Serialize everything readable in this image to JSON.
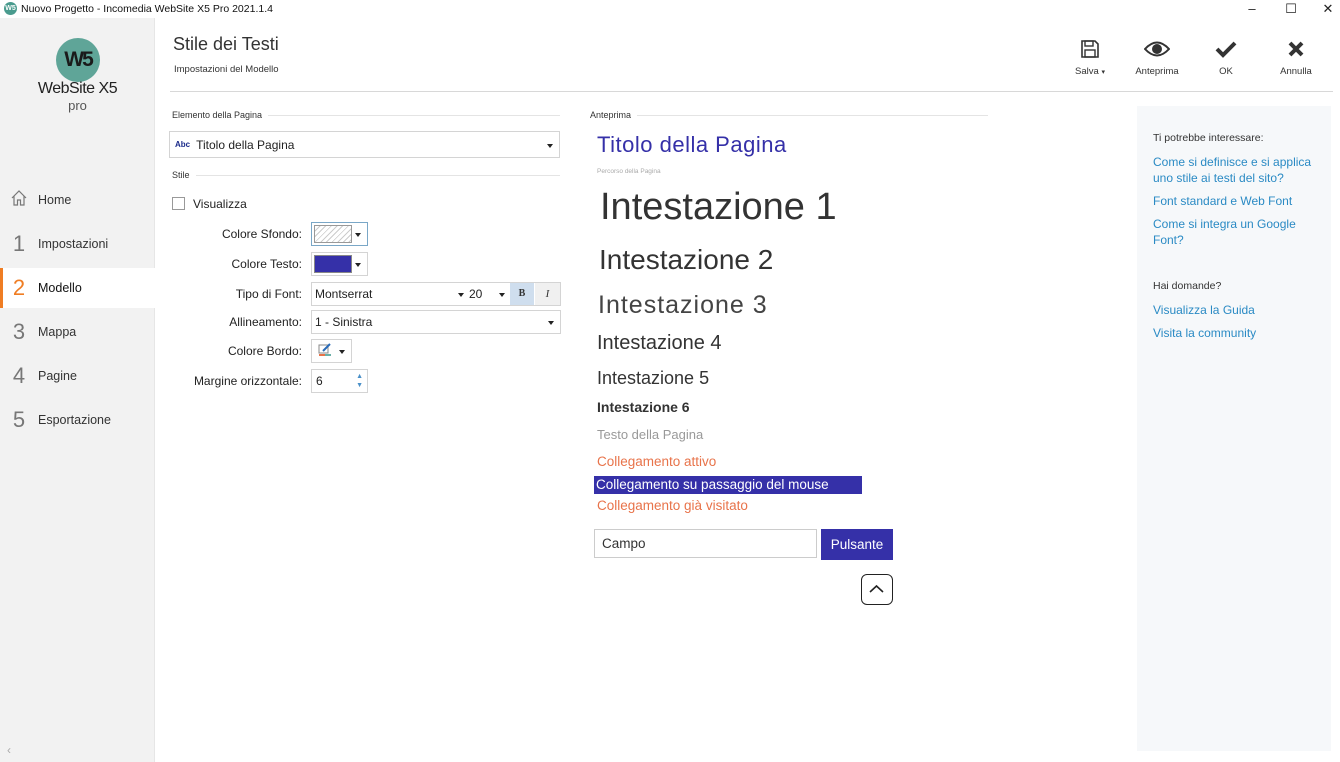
{
  "window": {
    "title": "Nuovo Progetto - Incomedia WebSite X5 Pro 2021.1.4",
    "app_icon": "W5",
    "controls": {
      "minimize": "–",
      "maximize": "☐",
      "close": "✕"
    }
  },
  "logo": {
    "mark": "W5",
    "name": "WebSite X5",
    "edition": "pro"
  },
  "sidebar": {
    "items": [
      {
        "num": "",
        "label": "Home",
        "icon": "home-icon"
      },
      {
        "num": "1",
        "label": "Impostazioni"
      },
      {
        "num": "2",
        "label": "Modello",
        "active": true
      },
      {
        "num": "3",
        "label": "Mappa"
      },
      {
        "num": "4",
        "label": "Pagine"
      },
      {
        "num": "5",
        "label": "Esportazione"
      }
    ],
    "collapse": "‹"
  },
  "header": {
    "title": "Stile dei Testi",
    "subtitle": "Impostazioni del Modello"
  },
  "toolbar": {
    "save": "Salva",
    "preview": "Anteprima",
    "ok": "OK",
    "cancel": "Annulla"
  },
  "form": {
    "element_section": "Elemento della Pagina",
    "element_icon": "Abc",
    "element_value": "Titolo della Pagina",
    "style_section": "Stile",
    "show_label": "Visualizza",
    "show_checked": false,
    "bg_color_label": "Colore Sfondo:",
    "text_color_label": "Colore Testo:",
    "text_color": "#3530a8",
    "font_label": "Tipo di Font:",
    "font_value": "Montserrat",
    "font_size": "20",
    "bold": "B",
    "italic": "I",
    "align_label": "Allineamento:",
    "align_value": "1 - Sinistra",
    "border_label": "Colore Bordo:",
    "margin_label": "Margine orizzontale:",
    "margin_value": "6"
  },
  "preview": {
    "section": "Anteprima",
    "title": "Titolo della Pagina",
    "breadcrumb": "Percorso della Pagina",
    "h1": "Intestazione 1",
    "h2": "Intestazione 2",
    "h3": "Intestazione 3",
    "h4": "Intestazione 4",
    "h5": "Intestazione 5",
    "h6": "Intestazione 6",
    "body": "Testo della Pagina",
    "link_active": "Collegamento attivo",
    "link_hover": "Collegamento su passaggio del mouse",
    "link_visited": "Collegamento già visitato",
    "field": "Campo",
    "button": "Pulsante",
    "colors": {
      "accent": "#3530a8",
      "link": "#e8734a"
    }
  },
  "help": {
    "interest_head": "Ti potrebbe interessare:",
    "links": [
      "Come si definisce e si applica uno stile ai testi del sito?",
      "Font standard e Web Font",
      "Come si integra un Google Font?"
    ],
    "questions_head": "Hai domande?",
    "support": [
      "Visualizza la Guida",
      "Visita la community"
    ]
  }
}
